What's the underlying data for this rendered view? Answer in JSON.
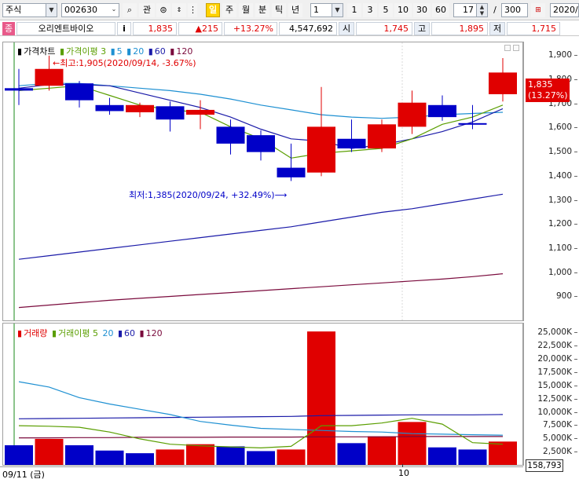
{
  "toolbar": {
    "market": "주식",
    "code": "002630",
    "btn_find": "관",
    "period_tabs": [
      "일",
      "주",
      "월",
      "분",
      "틱",
      "년"
    ],
    "unit_select": "1",
    "range_buttons": [
      "1",
      "3",
      "5",
      "10",
      "30",
      "60"
    ],
    "count": "17",
    "separator": "/",
    "total": "300",
    "date": "2020/"
  },
  "infobar": {
    "badge": "종",
    "name": "오리엔트바이오",
    "info_btn": "i",
    "price": "1,835",
    "change": "▲215",
    "change_pct": "+13.27%",
    "volume": "4,547,692",
    "open_label": "시",
    "open": "1,745",
    "high_label": "고",
    "high": "1,895",
    "low_label": "저",
    "low": "1,715"
  },
  "price_legend": {
    "title": "가격차트",
    "ma_label": "가격이평 3",
    "ma_periods": [
      "5",
      "20",
      "60",
      "120"
    ]
  },
  "volume_legend": {
    "title": "거래량",
    "ma_label": "거래이평 5",
    "ma_periods": [
      "20",
      "60",
      "120"
    ]
  },
  "annotations": {
    "high_note": "←최고:1,905(2020/09/14, -3.67%)",
    "low_note": "최저:1,385(2020/09/24, +32.49%)⟶"
  },
  "price_box": {
    "price": "1,835",
    "pct": "(13.27%)"
  },
  "volume_box": "158,793",
  "x_labels": {
    "start": "09/11 (금)",
    "mid": "10"
  },
  "colors": {
    "up": "#e00000",
    "down": "#0000c8",
    "ma3": "#5a9e00",
    "ma5": "#1e90d2",
    "ma20": "#1a1aa8",
    "ma60": "#7a0a3c"
  },
  "chart_data": [
    {
      "type": "candlestick",
      "title": "가격차트",
      "ylim": [
        800,
        1960
      ],
      "y_ticks": [
        1900,
        1800,
        1700,
        1600,
        1500,
        1400,
        1300,
        1200,
        1100,
        1000,
        900
      ],
      "y_tick_labels": [
        "1,900",
        "1,800",
        "1,700",
        "1,600",
        "1,500",
        "1,400",
        "1,300",
        "1,200",
        "1,100",
        "1,000",
        "900"
      ],
      "candles": [
        {
          "o": 1770,
          "c": 1760,
          "h": 1850,
          "l": 1700
        },
        {
          "o": 1780,
          "c": 1850,
          "h": 1905,
          "l": 1760
        },
        {
          "o": 1790,
          "c": 1720,
          "h": 1800,
          "l": 1690
        },
        {
          "o": 1700,
          "c": 1675,
          "h": 1730,
          "l": 1660
        },
        {
          "o": 1670,
          "c": 1700,
          "h": 1710,
          "l": 1650
        },
        {
          "o": 1695,
          "c": 1640,
          "h": 1715,
          "l": 1590
        },
        {
          "o": 1660,
          "c": 1680,
          "h": 1720,
          "l": 1600
        },
        {
          "o": 1610,
          "c": 1540,
          "h": 1640,
          "l": 1495
        },
        {
          "o": 1575,
          "c": 1505,
          "h": 1595,
          "l": 1470
        },
        {
          "o": 1440,
          "c": 1400,
          "h": 1540,
          "l": 1385
        },
        {
          "o": 1420,
          "c": 1610,
          "h": 1775,
          "l": 1405
        },
        {
          "o": 1560,
          "c": 1520,
          "h": 1640,
          "l": 1505
        },
        {
          "o": 1520,
          "c": 1620,
          "h": 1640,
          "l": 1505
        },
        {
          "o": 1610,
          "c": 1710,
          "h": 1760,
          "l": 1580
        },
        {
          "o": 1700,
          "c": 1650,
          "h": 1740,
          "l": 1635
        },
        {
          "o": 1625,
          "c": 1620,
          "h": 1700,
          "l": 1600
        },
        {
          "o": 1745,
          "c": 1835,
          "h": 1895,
          "l": 1715
        }
      ],
      "ma3": [
        1760,
        1770,
        1780,
        1740,
        1700,
        1680,
        1670,
        1610,
        1560,
        1480,
        1500,
        1510,
        1520,
        1560,
        1620,
        1650,
        1700
      ],
      "ma5": [
        1770,
        1785,
        1785,
        1780,
        1750,
        1720,
        1690,
        1650,
        1600,
        1560,
        1550,
        1520,
        1535,
        1560,
        1590,
        1630,
        1685
      ],
      "ma20": [
        1780,
        1790,
        1790,
        1780,
        1770,
        1760,
        1745,
        1725,
        1700,
        1680,
        1660,
        1650,
        1645,
        1650,
        1660,
        1665,
        1670
      ],
      "ma60": [
        1060,
        1075,
        1090,
        1105,
        1120,
        1135,
        1150,
        1165,
        1180,
        1195,
        1215,
        1235,
        1255,
        1270,
        1290,
        1310,
        1330
      ],
      "ma120": [
        860,
        870,
        880,
        890,
        898,
        906,
        914,
        922,
        930,
        938,
        946,
        954,
        962,
        970,
        978,
        988,
        1000
      ]
    },
    {
      "type": "bar",
      "title": "거래량",
      "ylim": [
        0,
        27000
      ],
      "y_ticks": [
        25000,
        22500,
        20000,
        17500,
        15000,
        12500,
        10000,
        7500,
        5000,
        2500
      ],
      "y_tick_labels": [
        "25,000K",
        "22,500K",
        "20,000K",
        "17,500K",
        "15,000K",
        "12,500K",
        "10,000K",
        "7,500K",
        "5,000K",
        "2,500K"
      ],
      "values": [
        4000,
        5200,
        4000,
        3000,
        2500,
        3200,
        4200,
        3800,
        2900,
        3200,
        25500,
        4400,
        5700,
        8400,
        3600,
        3200,
        4700
      ],
      "up": [
        false,
        true,
        false,
        false,
        false,
        true,
        true,
        false,
        false,
        true,
        true,
        false,
        true,
        true,
        false,
        false,
        true
      ],
      "ma5": [
        16000,
        15000,
        13000,
        11800,
        10800,
        9800,
        8500,
        7800,
        7200,
        7000,
        6800,
        6600,
        6500,
        6200,
        6100,
        6000,
        5900
      ],
      "ma20": [
        7700,
        7600,
        7400,
        6500,
        5200,
        4200,
        3900,
        3700,
        3500,
        3800,
        7700,
        7700,
        8200,
        9100,
        8000,
        4500,
        4200
      ],
      "ma60": [
        9000,
        9050,
        9100,
        9150,
        9200,
        9250,
        9300,
        9350,
        9400,
        9450,
        9600,
        9650,
        9700,
        9750,
        9750,
        9750,
        9800
      ],
      "ma120": [
        5400,
        5400,
        5450,
        5450,
        5500,
        5500,
        5500,
        5550,
        5550,
        5550,
        5600,
        5600,
        5600,
        5650,
        5650,
        5650,
        5650
      ]
    }
  ]
}
